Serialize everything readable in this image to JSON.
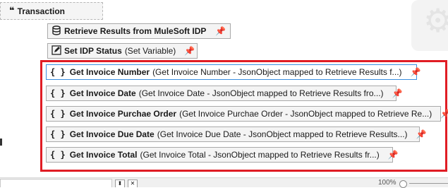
{
  "transaction": {
    "icon": "quote-icon",
    "label": "Transaction"
  },
  "activities": [
    {
      "icon": "database-icon",
      "name": "Retrieve Results from MuleSoft IDP",
      "detail": ""
    },
    {
      "icon": "edit-icon",
      "name": "Set IDP Status",
      "detail": "(Set Variable)"
    },
    {
      "icon": "curly-braces-icon",
      "name": "Get Invoice Number",
      "detail": "(Get Invoice Number - JsonObject mapped to Retrieve Results f...)"
    },
    {
      "icon": "curly-braces-icon",
      "name": "Get Invoice Date",
      "detail": "(Get Invoice Date - JsonObject mapped to Retrieve Results fro...)"
    },
    {
      "icon": "curly-braces-icon",
      "name": "Get Invoice Purchae Order",
      "detail": "(Get Invoice Purchae Order - JsonObject mapped to Retrieve Re...)"
    },
    {
      "icon": "curly-braces-icon",
      "name": "Get Invoice Due Date",
      "detail": "(Get Invoice Due Date - JsonObject mapped to Retrieve Results...)"
    },
    {
      "icon": "curly-braces-icon",
      "name": "Get Invoice Total",
      "detail": "(Get Invoice Total - JsonObject mapped to Retrieve Results fr...)"
    }
  ],
  "curly_glyph": "{ }",
  "pin_glyph": "📌",
  "zoom": {
    "label": "100%"
  },
  "colors": {
    "highlight": "#e01c24",
    "selected_border": "#3b8fe0"
  }
}
